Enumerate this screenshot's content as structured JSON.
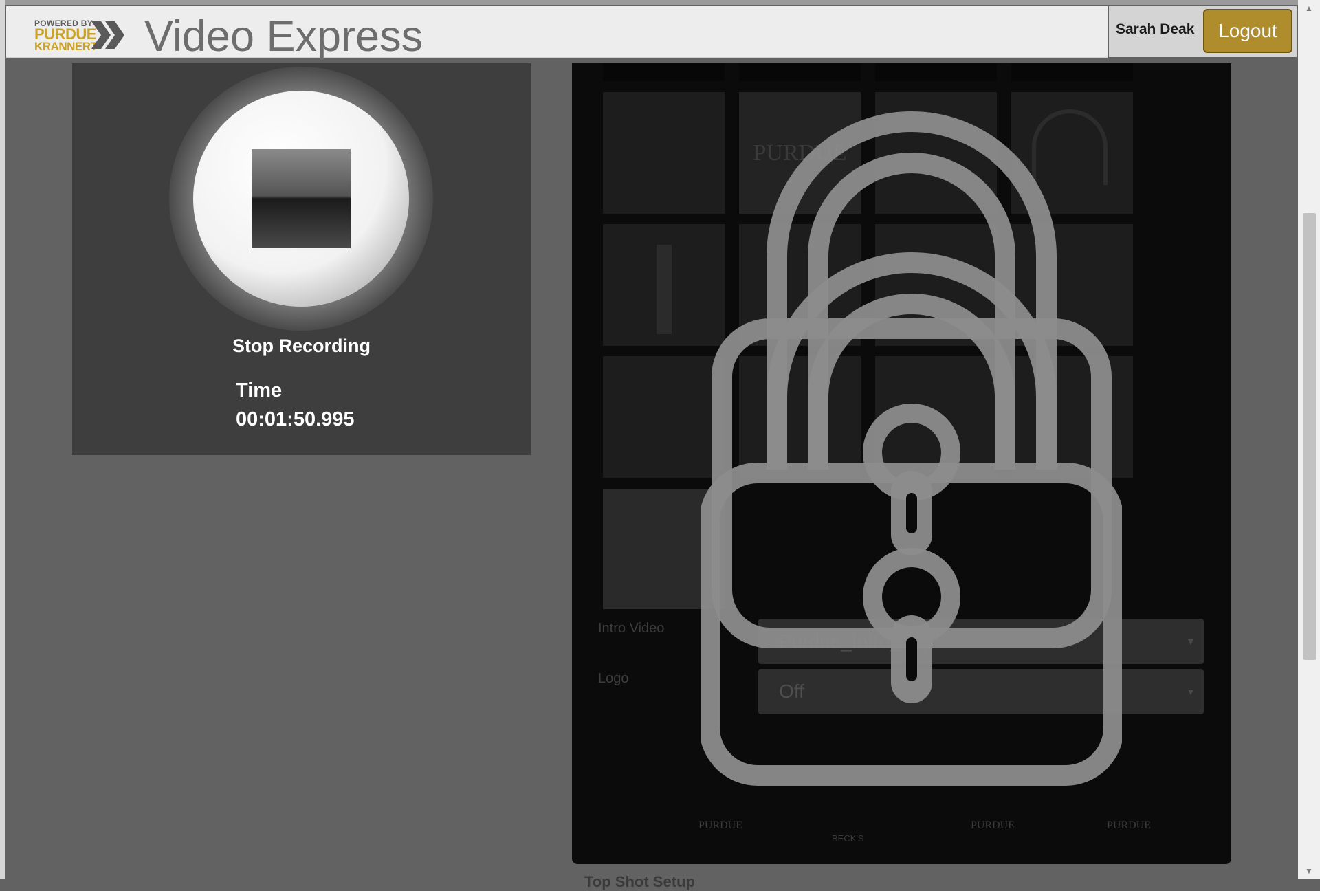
{
  "header": {
    "logo": {
      "line1": "POWERED BY",
      "line2": "PURDUE",
      "line3": "KRANNERT"
    },
    "app_title": "Video Express",
    "user_name": "Sarah Deak",
    "logout_label": "Logout"
  },
  "recorder": {
    "stop_label": "Stop Recording",
    "time_label": "Time",
    "time_value": "00:01:50.995"
  },
  "config": {
    "background_tile_captions": [
      "PURDUE"
    ],
    "intro_video": {
      "label": "Intro Video",
      "value": "Purdue_Intro_Clip"
    },
    "logo": {
      "label": "Logo",
      "value": "Off"
    },
    "footer_logos": [
      "PURDUE",
      "BECK'S",
      "PURDUE",
      "PURDUE"
    ],
    "peek_heading": "Top Shot Setup"
  },
  "overlay": {
    "icon": "lock-icon",
    "color": "#8c8c8c"
  },
  "colors": {
    "accent": "#b08d2c",
    "header_bg": "#ededed",
    "panel_bg": "#3e3e3e",
    "page_bg": "#626262"
  }
}
